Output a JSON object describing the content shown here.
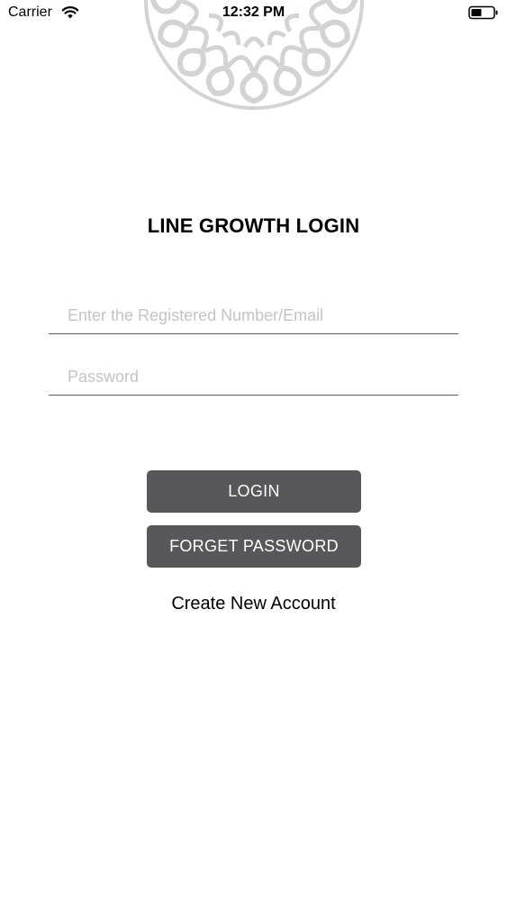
{
  "status_bar": {
    "carrier": "Carrier",
    "time": "12:32 PM",
    "wifi_icon": "wifi-icon",
    "battery_icon": "battery-icon"
  },
  "login": {
    "title": "LINE GROWTH LOGIN",
    "email_placeholder": "Enter the Registered Number/Email",
    "email_value": "",
    "password_placeholder": "Password",
    "password_value": "",
    "login_label": "LOGIN",
    "forget_label": "FORGET PASSWORD",
    "create_account_label": "Create New Account"
  },
  "colors": {
    "button_bg": "#58575a",
    "button_text": "#ffffff",
    "underline": "#5a5a5a",
    "placeholder": "#c4c4c8",
    "mandala": "#d3d3d6"
  },
  "decoration": {
    "logo_icon": "mandala-icon"
  }
}
